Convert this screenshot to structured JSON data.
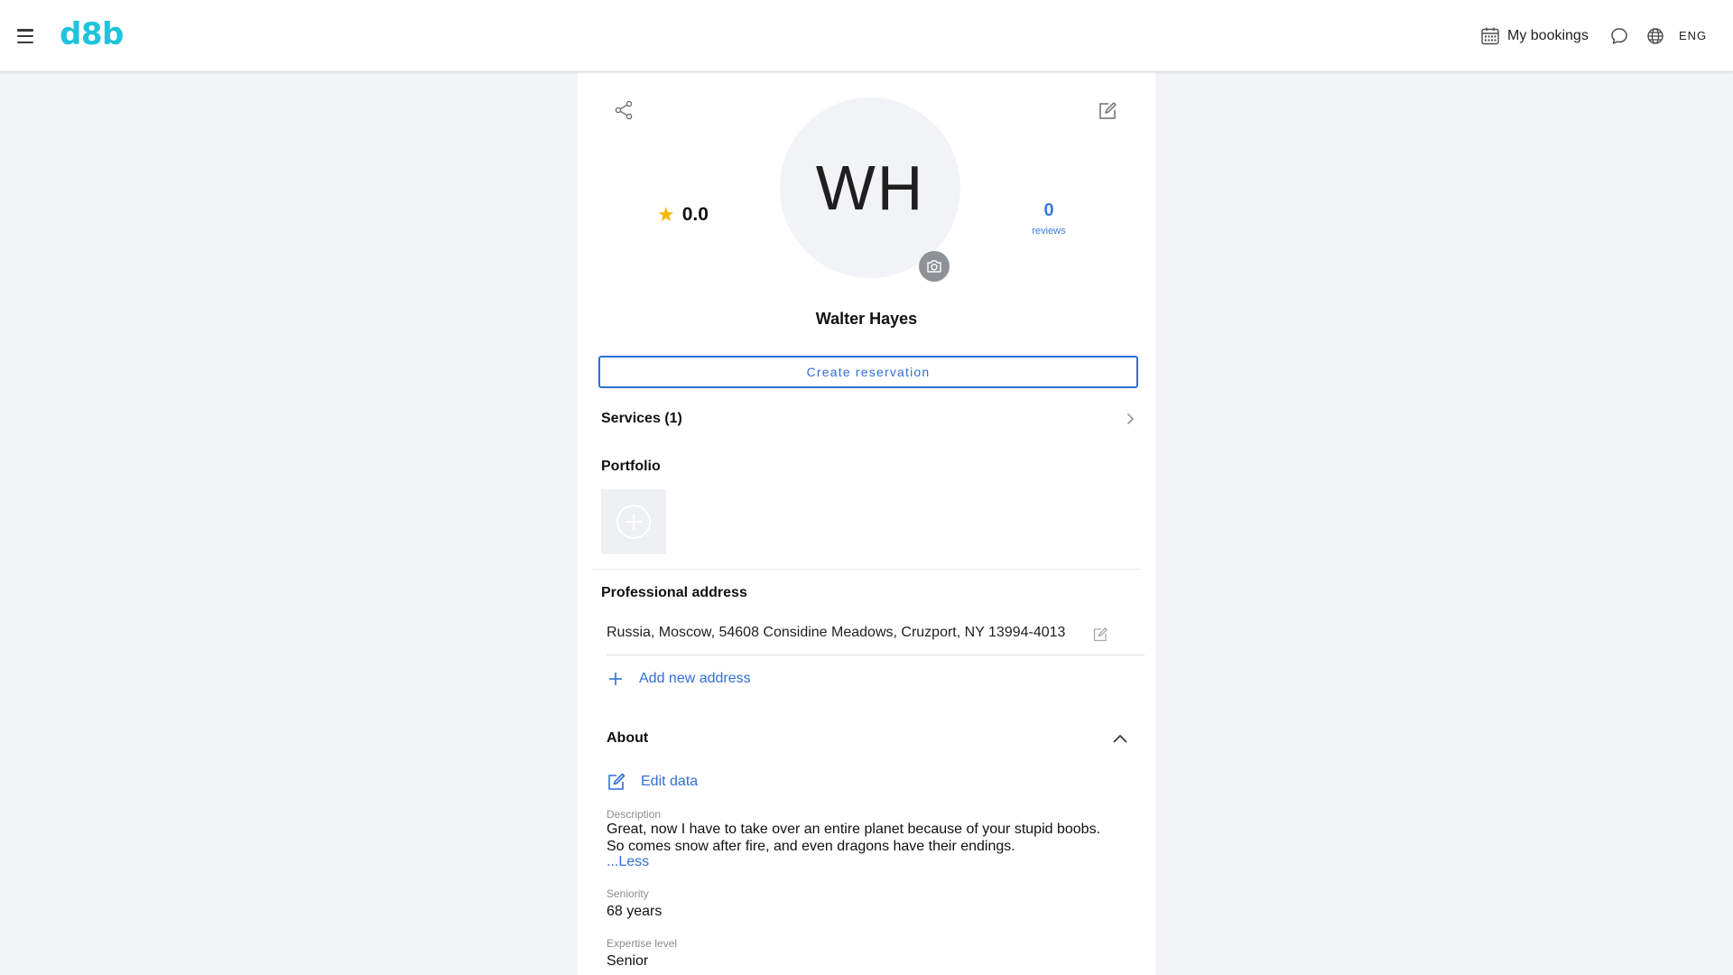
{
  "header": {
    "logo": "d8b",
    "bookings_label": "My bookings",
    "language": "ENG",
    "icons": [
      "menu-icon",
      "calendar-icon",
      "chat-icon",
      "globe-icon"
    ]
  },
  "profile": {
    "rating": "0.0",
    "initials": "WH",
    "reviews_count": "0",
    "reviews_label": "reviews",
    "name": "Walter Hayes",
    "create_reservation_label": "Create reservation"
  },
  "services": {
    "label": "Services (1)"
  },
  "portfolio": {
    "title": "Portfolio"
  },
  "address": {
    "title": "Professional address",
    "items": [
      "Russia, Moscow, 54608 Considine Meadows, Cruzport, NY 13994-4013"
    ],
    "add_label": "Add new address"
  },
  "about": {
    "title": "About",
    "edit_label": "Edit data",
    "description_label": "Description",
    "description": "Great, now I have to take over an entire planet because of your stupid boobs. So comes snow after fire, and even dragons have their endings.",
    "less_label": "...Less",
    "seniority_label": "Seniority",
    "seniority": "68 years",
    "expertise_label": "Expertise level",
    "expertise": "Senior"
  },
  "colors": {
    "accent": "#2f6fd6",
    "brand": "#1ec3dc",
    "star": "#f5b800",
    "background": "#f3f4f7"
  }
}
